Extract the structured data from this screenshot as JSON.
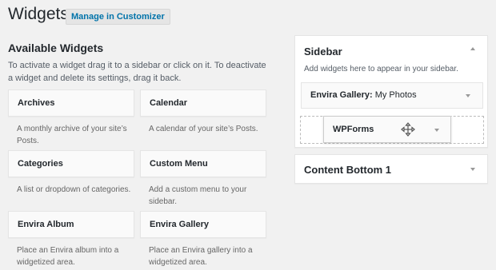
{
  "header": {
    "title": "Widgets",
    "customizer_label": "Manage in Customizer"
  },
  "available": {
    "title": "Available Widgets",
    "description": "To activate a widget drag it to a sidebar or click on it. To deactivate a widget and delete its settings, drag it back.",
    "widgets": [
      {
        "name": "Archives",
        "description": "A monthly archive of your site’s Posts."
      },
      {
        "name": "Calendar",
        "description": "A calendar of your site’s Posts."
      },
      {
        "name": "Categories",
        "description": "A list or dropdown of categories."
      },
      {
        "name": "Custom Menu",
        "description": "Add a custom menu to your sidebar."
      },
      {
        "name": "Envira Album",
        "description": "Place an Envira album into a widgetized area."
      },
      {
        "name": "Envira Gallery",
        "description": "Place an Envira gallery into a widgetized area."
      }
    ]
  },
  "sidebar": {
    "title": "Sidebar",
    "description": "Add widgets here to appear in your sidebar.",
    "placed_widget": {
      "name": "Envira Gallery:",
      "subtitle": " My Photos"
    },
    "dragging_widget": "WPForms"
  },
  "content_bottom": {
    "title": "Content Bottom 1"
  },
  "icons": {
    "toggle_open": "arrow-up-icon",
    "toggle_closed": "arrow-down-icon",
    "drag": "move-icon"
  },
  "colors": {
    "link": "#0073aa",
    "background": "#f1f1f1",
    "panel": "#ffffff"
  }
}
